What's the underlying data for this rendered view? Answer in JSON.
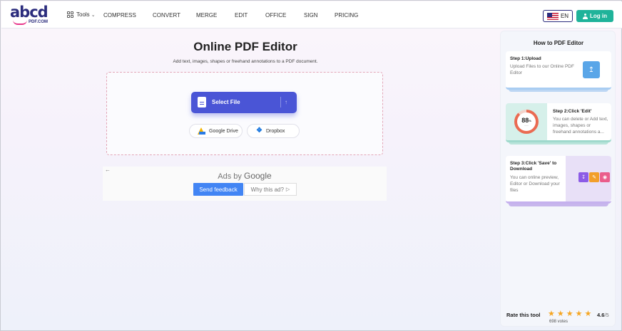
{
  "header": {
    "logo_main": "abcd",
    "logo_sub": "PDF.COM",
    "tools_label": "Tools",
    "nav": [
      "COMPRESS",
      "CONVERT",
      "MERGE",
      "EDIT",
      "OFFICE",
      "SIGN",
      "PRICING"
    ],
    "lang": "EN",
    "login": "Log in"
  },
  "main": {
    "title": "Online PDF Editor",
    "subtitle": "Add text, images, shapes or freehand annotations to a PDF document.",
    "select_file": "Select File",
    "google_drive": "Google Drive",
    "dropbox": "Dropbox"
  },
  "ad": {
    "ads_by": "Ads by",
    "google": "Google",
    "send_feedback": "Send feedback",
    "why": "Why this ad?"
  },
  "panel": {
    "title": "How to PDF Editor",
    "steps": [
      {
        "title": "Step 1:Upload",
        "desc": "Upload Files to our Online PDF Editor",
        "color": "#d7e6f7"
      },
      {
        "title": "Step 2:Click 'Edit'",
        "desc": "You can delete or Add text, images, shapes or freehand annotations a...",
        "color": "#d2efe9",
        "ring_value": "88",
        "ring_unit": "%"
      },
      {
        "title": "Step 3:Click 'Save' to Download",
        "desc": "You can online preview, Editor or Download your files",
        "color": "#e6dcf6"
      }
    ],
    "rate_label": "Rate this tool",
    "rating": "4.6",
    "rating_max": "/5",
    "stars": 5,
    "votes": "698 votes"
  },
  "colors": {
    "brand": "#2b2c7d",
    "accent": "#4a55d6",
    "login_green": "#1fb39a",
    "star": "#f5a623"
  }
}
